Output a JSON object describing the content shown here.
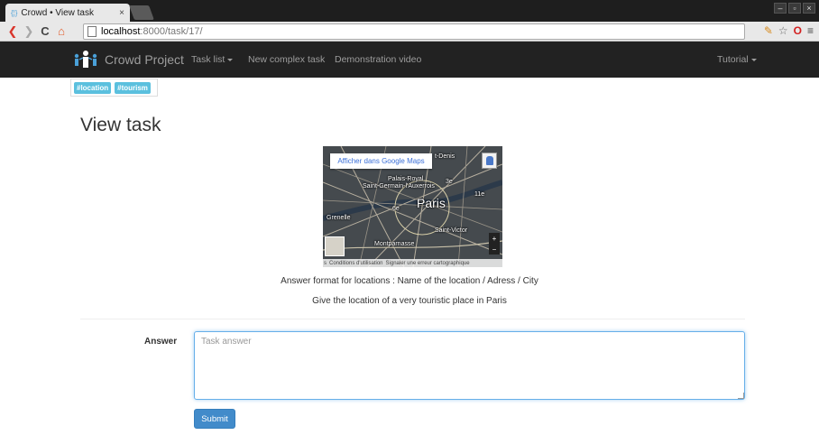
{
  "browser": {
    "tab_title": "Crowd • View task",
    "tab_favicon": "{¦}",
    "tab_close": "×",
    "url_host": "localhost",
    "url_path": ":8000/task/17/",
    "window_buttons": [
      "–",
      "▫",
      "×"
    ],
    "icons": [
      "back-icon",
      "forward-icon",
      "reload-icon",
      "home-icon",
      "page-icon",
      "extension-icon",
      "star-icon",
      "opera-icon",
      "menu-icon"
    ]
  },
  "navbar": {
    "brand": "Crowd Project",
    "links": [
      {
        "label": "Task list",
        "dropdown": true
      },
      {
        "label": "New complex task",
        "dropdown": false
      },
      {
        "label": "Demonstration video",
        "dropdown": false
      }
    ],
    "right_link": {
      "label": "Tutorial",
      "dropdown": true
    }
  },
  "tags": [
    "#location",
    "#tourism"
  ],
  "page_title": "View task",
  "map": {
    "button_label": "Afficher dans Google Maps",
    "labels": {
      "city": "Paris",
      "denis": "t-Denis",
      "palais": "Palais-Royal",
      "saint_germain": "Saint-Germain-l'Auxerrois",
      "arr_3": "3e",
      "arr_11": "11e",
      "arr_6": "6e",
      "grenelle": "Grenelle",
      "saint_victor": "Saint-Victor",
      "montparnasse": "Montparnasse"
    },
    "zoom_in": "+",
    "zoom_out": "−",
    "footer": [
      "s",
      "Conditions d'utilisation",
      "Signaler une erreur cartographique"
    ]
  },
  "task": {
    "format": "Answer format for locations : Name of the location / Adress / City",
    "question": "Give the location of a very touristic place in Paris"
  },
  "form": {
    "answer_label": "Answer",
    "answer_placeholder": "Task answer",
    "answer_value": "",
    "submit_label": "Submit"
  },
  "colors": {
    "navbar_bg": "#222222",
    "tag_bg": "#5bc0de",
    "primary": "#428bca",
    "input_focus": "#66afe9"
  }
}
